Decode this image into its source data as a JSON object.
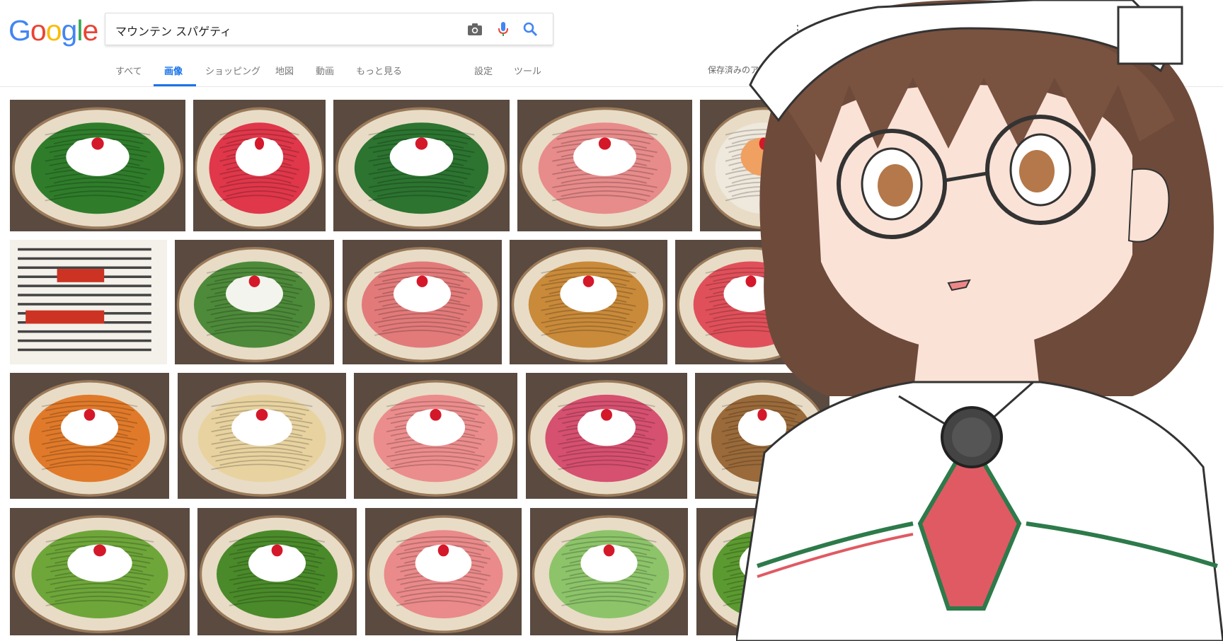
{
  "search": {
    "query": "マウンテン スパゲティ"
  },
  "logo": {
    "text": [
      "G",
      "o",
      "o",
      "g",
      "l",
      "e"
    ],
    "colors": [
      "#4285F4",
      "#EA4335",
      "#FBBC05",
      "#4285F4",
      "#34A853",
      "#EA4335"
    ]
  },
  "tabs": {
    "all": "すべて",
    "images": "画像",
    "shopping": "ショッピング",
    "maps": "地図",
    "videos": "動画",
    "more": "もっと見る",
    "settings": "設定",
    "tools": "ツール",
    "saved": "保存済みのアイテムを"
  },
  "accent": "#1a73e8",
  "icons": [
    "camera-icon",
    "microphone-icon",
    "search-icon",
    "apps-grid-icon"
  ],
  "results": [
    {
      "label": "green spaghetti with cream, cherry and peach",
      "noodle": "#2f7d2b",
      "cream": "#ffffff"
    },
    {
      "label": "red spaghetti with cream and strawberries",
      "noodle": "#e0374a",
      "cream": "#ffffff"
    },
    {
      "label": "green spaghetti with cream and cherry",
      "noodle": "#2c7430",
      "cream": "#ffffff"
    },
    {
      "label": "pink spaghetti with cream and kiwi",
      "noodle": "#e88b8b",
      "cream": "#ffffff"
    },
    {
      "label": "noodles in clay pot",
      "noodle": "#efe8dc",
      "cream": "#f0a060"
    },
    {
      "label": "menu card",
      "noodle": "#f4f0ea",
      "cream": "#cc3322"
    },
    {
      "label": "green spaghetti with cream lattice",
      "noodle": "#4d8a3a",
      "cream": "#f4f4ee"
    },
    {
      "label": "pink spaghetti with strawberries and kiwi",
      "noodle": "#e27a7a",
      "cream": "#ffffff"
    },
    {
      "label": "brown spaghetti with chocolate and cream",
      "noodle": "#c98a3a",
      "cream": "#ffffff"
    },
    {
      "label": "red spaghetti with kiwi and cream",
      "noodle": "#e0505a",
      "cream": "#ffffff"
    },
    {
      "label": "orange spaghetti with cream and banana",
      "noodle": "#e07a2a",
      "cream": "#ffffff"
    },
    {
      "label": "spaghetti with banana and chocolate",
      "noodle": "#e8d3a0",
      "cream": "#ffffff"
    },
    {
      "label": "pink spaghetti with strawberry and kiwi",
      "noodle": "#ec8d8d",
      "cream": "#ffffff"
    },
    {
      "label": "magenta spaghetti with cream and kiwi",
      "noodle": "#d65070",
      "cream": "#ffffff"
    },
    {
      "label": "fried rice with egg",
      "noodle": "#9a6a3a",
      "cream": "#ffffff"
    },
    {
      "label": "green spaghetti with cream and cherry",
      "noodle": "#6ea63a",
      "cream": "#ffffff"
    },
    {
      "label": "green spaghetti with cherry and peach",
      "noodle": "#4a8a2a",
      "cream": "#ffffff"
    },
    {
      "label": "pink spaghetti with strawberries",
      "noodle": "#ea8a8a",
      "cream": "#ffffff"
    },
    {
      "label": "green spaghetti with cream lattice",
      "noodle": "#8dc46a",
      "cream": "#ffffff"
    },
    {
      "label": "green spaghetti with cherry and cream",
      "noodle": "#5b9a30",
      "cream": "#ffffff"
    }
  ],
  "overlay": {
    "character": "anime girl with glasses"
  }
}
